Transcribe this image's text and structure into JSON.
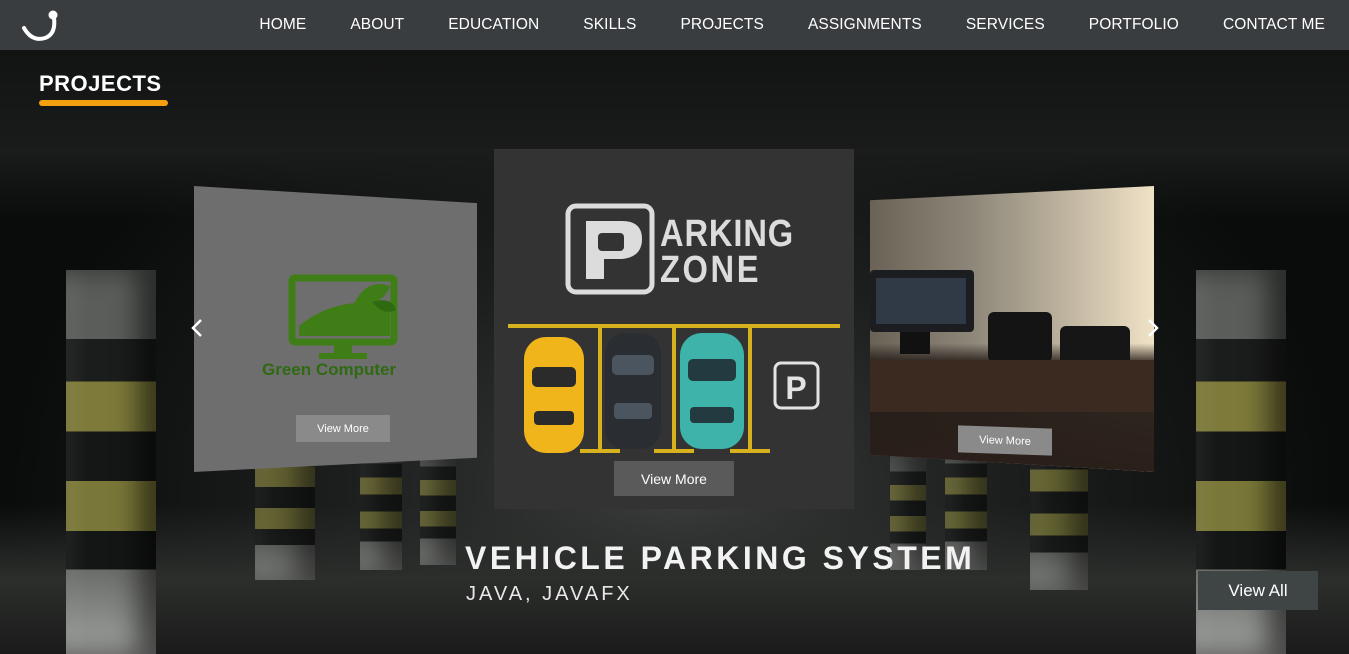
{
  "nav": {
    "logo_icon": "hook-logo-icon",
    "links": [
      "HOME",
      "ABOUT",
      "EDUCATION",
      "SKILLS",
      "PROJECTS",
      "ASSIGNMENTS",
      "SERVICES",
      "PORTFOLIO",
      "CONTACT ME"
    ]
  },
  "section": {
    "title": "PROJECTS",
    "accent_color": "#f5a10f"
  },
  "carousel": {
    "left_card": {
      "logo_text": "Green Computer",
      "button": "View More"
    },
    "center_card": {
      "logo_line1": "ARKING",
      "logo_line2": "ZONE",
      "logo_badge": "P",
      "lot_badge": "P",
      "button": "View More"
    },
    "right_card": {
      "button": "View More"
    },
    "prev_icon": "chevron-left-icon",
    "next_icon": "chevron-right-icon"
  },
  "project": {
    "title": "VEHICLE PARKING SYSTEM",
    "tech": "JAVA, JAVAFX"
  },
  "view_all": "View All"
}
